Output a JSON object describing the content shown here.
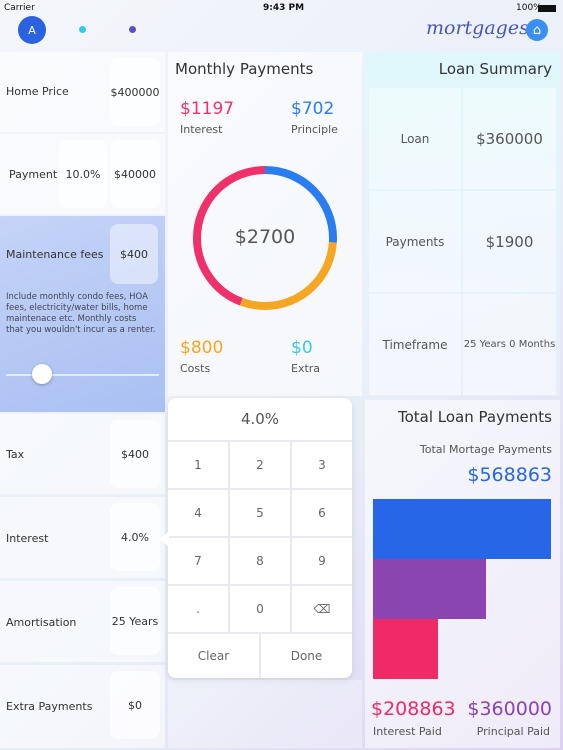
{
  "status": {
    "carrier": "Carrier",
    "time": "9:43 PM",
    "battery": "100%"
  },
  "header": {
    "avatar": "A",
    "title": "mortgages",
    "home_icon": "home-icon",
    "dot_colors": [
      "#2ecbea",
      "#5a4fc7"
    ]
  },
  "inputs": {
    "home_price": {
      "label": "Home Price",
      "value": "$400000"
    },
    "payment": {
      "label": "Payment",
      "percent": "10.0%",
      "value": "$40000"
    },
    "maintenance": {
      "label": "Maintenance fees",
      "value": "$400",
      "note": "Include monthly condo fees, HOA fees, electricity/water bills, home maintenace etc. Monthly costs that you wouldn't incur as a renter.",
      "slider_fraction": 0.22
    },
    "tax": {
      "label": "Tax",
      "value": "$400"
    },
    "interest": {
      "label": "Interest",
      "value": "4.0%"
    },
    "amortisation": {
      "label": "Amortisation",
      "value": "25 Years"
    },
    "extra": {
      "label": "Extra Payments",
      "value": "$0"
    }
  },
  "monthly": {
    "title": "Monthly Payments",
    "total": "$2700",
    "interest": {
      "value": "$1197",
      "label": "Interest",
      "color": "#f0306a"
    },
    "principle": {
      "value": "$702",
      "label": "Principle",
      "color": "#2a7df0"
    },
    "costs": {
      "value": "$800",
      "label": "Costs",
      "color": "#f5a623"
    },
    "extra": {
      "value": "$0",
      "label": "Extra",
      "color": "#3cc8e8"
    }
  },
  "keypad": {
    "display": "4.0%",
    "keys": [
      "1",
      "2",
      "3",
      "4",
      "5",
      "6",
      "7",
      "8",
      "9",
      ".",
      "0",
      "⌫"
    ],
    "clear": "Clear",
    "done": "Done"
  },
  "summary": {
    "title": "Loan Summary",
    "rows": [
      {
        "label": "Loan",
        "value": "$360000"
      },
      {
        "label": "Payments",
        "value": "$1900"
      },
      {
        "label": "Timeframe",
        "value": "25 Years 0 Months"
      }
    ]
  },
  "total": {
    "title": "Total Loan Payments",
    "subtitle": "Total Mortage Payments",
    "value": "$568863",
    "interest_paid": "$208863",
    "interest_label": "Interest Paid",
    "principal_paid": "$360000",
    "principal_label": "Principal Paid",
    "bars": [
      {
        "value": 568863,
        "color": "#2866e8"
      },
      {
        "value": 360000,
        "color": "#8a45b0"
      },
      {
        "value": 208863,
        "color": "#f02a66"
      }
    ]
  }
}
